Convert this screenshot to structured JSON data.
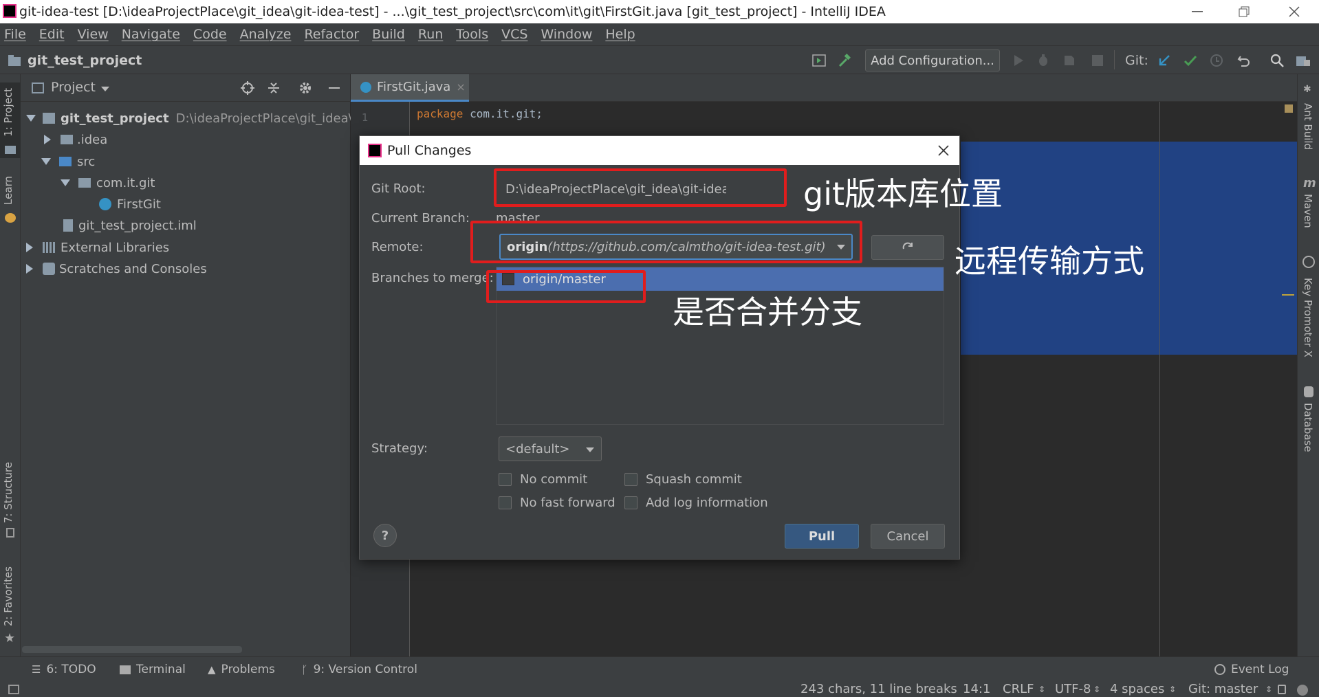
{
  "window": {
    "title": "git-idea-test [D:\\ideaProjectPlace\\git_idea\\git-idea-test] - ...\\git_test_project\\src\\com\\it\\git\\FirstGit.java [git_test_project] - IntelliJ IDEA"
  },
  "menu": [
    "File",
    "Edit",
    "View",
    "Navigate",
    "Code",
    "Analyze",
    "Refactor",
    "Build",
    "Run",
    "Tools",
    "VCS",
    "Window",
    "Help"
  ],
  "navbar": {
    "project": "git_test_project",
    "add_configuration": "Add Configuration...",
    "git_label": "Git:"
  },
  "left_tabs": {
    "project": "1: Project",
    "learn": "Learn",
    "structure": "7: Structure",
    "favorites": "2: Favorites"
  },
  "right_tabs": {
    "ant": "Ant Build",
    "maven": "Maven",
    "key_promoter": "Key Promoter X",
    "database": "Database"
  },
  "project_panel": {
    "header": "Project",
    "tree": [
      {
        "label": "git_test_project",
        "suffix": "D:\\ideaProjectPlace\\git_idea\\git"
      },
      {
        "label": ".idea"
      },
      {
        "label": "src"
      },
      {
        "label": "com.it.git"
      },
      {
        "label": "FirstGit"
      },
      {
        "label": "git_test_project.iml"
      },
      {
        "label": "External Libraries"
      },
      {
        "label": "Scratches and Consoles"
      }
    ]
  },
  "editor": {
    "tab": "FirstGit.java",
    "line1_keyword": "package",
    "line1_rest": " com.it.git;",
    "line_number": "1"
  },
  "dialog": {
    "title": "Pull Changes",
    "git_root_label": "Git Root:",
    "git_root_value": "D:\\ideaProjectPlace\\git_idea\\git-idea-test",
    "current_branch_label": "Current Branch:",
    "current_branch_value": "master",
    "remote_label": "Remote:",
    "remote_name": "origin",
    "remote_url": "(https://github.com/calmtho/git-idea-test.git)",
    "branches_label": "Branches to merge:",
    "branch_item": "origin/master",
    "strategy_label": "Strategy:",
    "strategy_value": "<default>",
    "no_commit": "No commit",
    "squash_commit": "Squash commit",
    "no_fast_forward": "No fast forward",
    "add_log": "Add log information",
    "help": "?",
    "pull": "Pull",
    "cancel": "Cancel"
  },
  "annotations": {
    "git_root": "git版本库位置",
    "remote": "远程传输方式",
    "merge": "是否合并分支"
  },
  "bottom_tabs": {
    "todo": "6: TODO",
    "terminal": "Terminal",
    "problems": "Problems",
    "vcs": "9: Version Control",
    "event_log": "Event Log"
  },
  "status": {
    "chars": "243 chars, 11 line breaks",
    "position": "14:1",
    "line_sep": "CRLF",
    "encoding": "UTF-8",
    "indent": "4 spaces",
    "branch": "Git: master"
  },
  "colors": {
    "accent": "#4a88c7",
    "selection": "#4b6eaf",
    "annotation_red": "#e01d1d",
    "vcs_update": "#3592c4",
    "vcs_commit": "#499c54"
  }
}
